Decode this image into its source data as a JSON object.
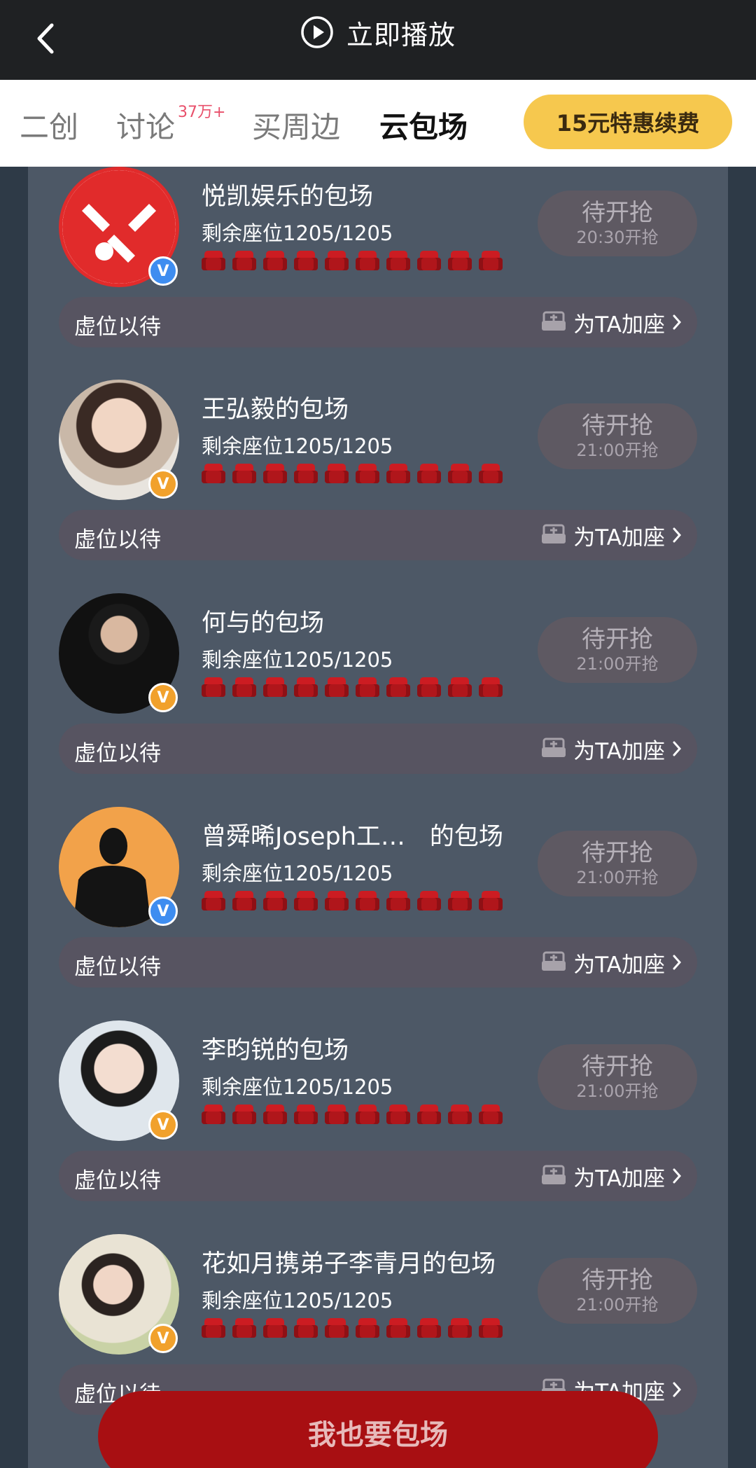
{
  "header": {
    "back_icon": "chevron-left-icon",
    "play_icon": "play-circle-icon",
    "play_label": "立即播放"
  },
  "tabs": {
    "items": [
      {
        "label": "二创"
      },
      {
        "label": "讨论"
      },
      {
        "label": "买周边"
      },
      {
        "label": "云包场"
      }
    ],
    "discussion_badge": "37万+",
    "active_tab": "云包场",
    "promo_label": "15元特惠续费"
  },
  "list": {
    "cards": [
      {
        "title": "悦凯娱乐的包场",
        "seats": "剩余座位1205/1205",
        "status": "待开抢",
        "time": "20:30开抢",
        "wait": "虚位以待",
        "add_seat": "为TA加座",
        "badge": "V"
      },
      {
        "title": "王弘毅的包场",
        "seats": "剩余座位1205/1205",
        "status": "待开抢",
        "time": "21:00开抢",
        "wait": "虚位以待",
        "add_seat": "为TA加座",
        "badge": "V"
      },
      {
        "title": "何与的包场",
        "seats": "剩余座位1205/1205",
        "status": "待开抢",
        "time": "21:00开抢",
        "wait": "虚位以待",
        "add_seat": "为TA加座",
        "badge": "V"
      },
      {
        "title": "曾舜晞Joseph工…　的包场",
        "seats": "剩余座位1205/1205",
        "status": "待开抢",
        "time": "21:00开抢",
        "wait": "虚位以待",
        "add_seat": "为TA加座",
        "badge": "V"
      },
      {
        "title": "李昀锐的包场",
        "seats": "剩余座位1205/1205",
        "status": "待开抢",
        "time": "21:00开抢",
        "wait": "虚位以待",
        "add_seat": "为TA加座",
        "badge": "V"
      },
      {
        "title": "花如月携弟子李青月的包场",
        "seats": "剩余座位1205/1205",
        "status": "待开抢",
        "time": "21:00开抢",
        "wait": "虚位以待",
        "add_seat": "为TA加座",
        "badge": "V"
      }
    ]
  },
  "cta": {
    "label": "我也要包场"
  },
  "colors": {
    "accent_yellow": "#f6c84e",
    "cta_red": "#a80f12",
    "seat_red": "#cc1c22",
    "badge_blue": "#3e8df0",
    "badge_orange": "#f1a12c"
  }
}
